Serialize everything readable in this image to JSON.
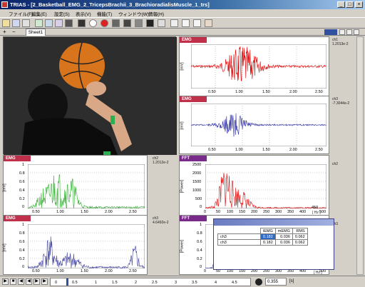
{
  "titlebar": {
    "title": "TRIAS - [2_Basketball_EMG_2_TricepsBrachii_3_BrachioradialisMuscle_1_trs]"
  },
  "menu": [
    "ファイル(F)",
    "編集(E)",
    "設定(S)",
    "表示(V)",
    "機能(T)",
    "ウィンドウ(W)",
    "情報(H)"
  ],
  "tabs": {
    "sheet": "Sheet1",
    "add": "+",
    "remove": "−"
  },
  "panels": {
    "emg_top": {
      "header": "EMG",
      "ylabel": "[mV]",
      "side": [
        "ch1",
        "1.2013e-2"
      ],
      "xticks": [
        "0.50",
        "1.00",
        "1.50",
        "2.00",
        "2.50"
      ],
      "color": "#e00000"
    },
    "emg_mid": {
      "header": "EMG",
      "ylabel": "[mV]",
      "side": [
        "ch3",
        "-7.3044e-2"
      ],
      "xticks": [
        "0.50",
        "1.00",
        "1.50",
        "2.00",
        "2.50"
      ],
      "color": "#3030a0"
    },
    "emg_left": {
      "header": "EMG",
      "ylabel": "[mV]",
      "side": [
        "ch2",
        "1.2012e-2"
      ],
      "yticks": [
        "1",
        "0.8",
        "0.6",
        "0.4",
        "0.2",
        "0"
      ],
      "xticks": [
        "0.50",
        "1.00",
        "1.50",
        "2.00",
        "2.50"
      ],
      "color": "#30b030"
    },
    "fft_right": {
      "header": "FFT",
      "ylabel": "[Power]",
      "side": [
        "ch2"
      ],
      "yticks": [
        "2500",
        "2000",
        "1500",
        "1000",
        "500",
        "0"
      ],
      "xticks": [
        "0",
        "50",
        "100",
        "150",
        "200",
        "250",
        "300",
        "350",
        "400",
        "450",
        "500"
      ],
      "xunit": "[ Hz ]",
      "color": "#e00000"
    },
    "emg_bottom": {
      "header": "EMG",
      "ylabel": "[mV]",
      "side": [
        "ch3",
        "4.6492e-2"
      ],
      "yticks": [
        "1",
        "0.8",
        "0.6",
        "0.4",
        "0.2",
        "0"
      ],
      "xticks": [
        "0.50",
        "1.00",
        "1.50",
        "2.00",
        "2.50"
      ],
      "color": "#4040a0"
    },
    "fft_bottom": {
      "header": "FFT",
      "ylabel": "[Power]",
      "side": [
        "ch3"
      ],
      "yticks": [
        "1",
        "0.8",
        "0.6",
        "0.4",
        "0.2",
        "0"
      ],
      "xticks": [
        "0",
        "50",
        "100",
        "150",
        "200",
        "250",
        "300",
        "350",
        "400",
        "450",
        "500"
      ],
      "xunit": "[ Hz ]",
      "color": "#3030a0"
    }
  },
  "stats": {
    "headers": [
      "iEMG",
      "mEMG",
      "RMS"
    ],
    "rows": [
      {
        "label": "ch3",
        "values": [
          "0.182",
          "0.036",
          "0.062"
        ]
      },
      {
        "label": "ch3",
        "values": [
          "0.182",
          "0.036",
          "0.062"
        ]
      }
    ]
  },
  "timeline": {
    "ticks": [
      "0",
      "0.5",
      "1",
      "1.5",
      "2",
      "2.5",
      "3",
      "3.5",
      "4",
      "4.5"
    ],
    "time_value": "0.355",
    "time_unit": "[s]"
  },
  "colors": {
    "emg_header": "#c0304a",
    "fft_header": "#7a2a8a",
    "selection": "#316ac5"
  }
}
